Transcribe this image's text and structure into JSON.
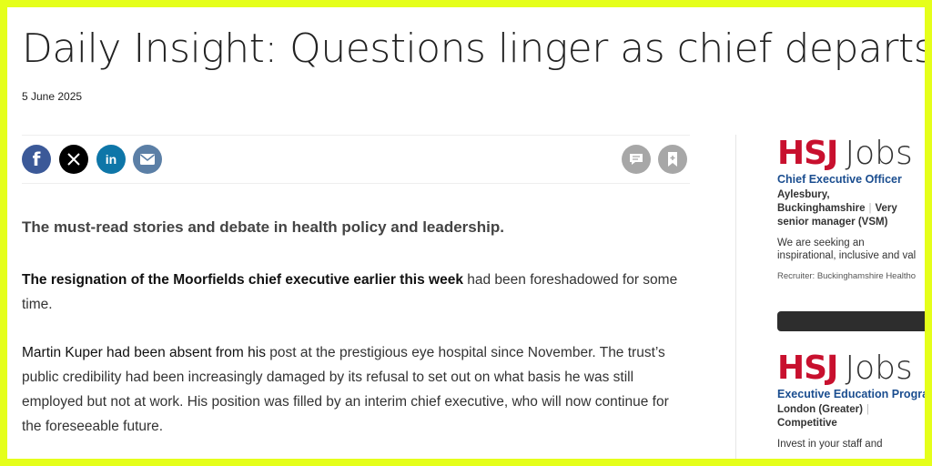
{
  "article": {
    "title": "Daily Insight: Questions linger as chief departs",
    "date": "5 June 2025",
    "standfirst": "The must-read stories and debate in health policy and leadership.",
    "paragraph1_lead": "The resignation of the Moorfields chief executive earlier this week",
    "paragraph1_rest": " had been foreshadowed for some time.",
    "paragraph2_lead": "Martin Kuper had been absent from his",
    "paragraph2_rest": " post at the prestigious eye hospital since November. The trust’s public credibility had been increasingly damaged by its refusal to set out on what basis he was still employed but not at work. His position was filled by an interim chief executive, who will now continue for the foreseeable future."
  },
  "share": {
    "icons": [
      "facebook-icon",
      "x-icon",
      "linkedin-icon",
      "email-icon",
      "comment-icon",
      "bookmark-icon"
    ],
    "facebook_glyph": "f",
    "linkedin_glyph": "in"
  },
  "sidebar": {
    "ads": [
      {
        "logo_brand": "HSJ",
        "logo_suffix": "Jobs",
        "job_title": "Chief Executive Officer",
        "location": "Aylesbury, Buckinghamshire",
        "salary": "Very senior manager (VSM)",
        "description_line1": "We are seeking an",
        "description_line2": "inspirational, inclusive and val",
        "recruiter": "Recruiter: Buckinghamshire Healtho"
      },
      {
        "logo_brand": "HSJ",
        "logo_suffix": "Jobs",
        "job_title": "Executive Education Progra",
        "location": "London (Greater)",
        "salary": "Competitive",
        "description_line1": "Invest in your staff and",
        "description_line2": ""
      }
    ]
  },
  "colors": {
    "frame_border": "#e5ff1a",
    "facebook": "#3b5998",
    "x": "#000000",
    "linkedin": "#0e76a8",
    "email": "#5b7fa6",
    "action_grey": "#a7a7a7",
    "hsj_red": "#c8102e",
    "job_link": "#1a4d8f"
  }
}
